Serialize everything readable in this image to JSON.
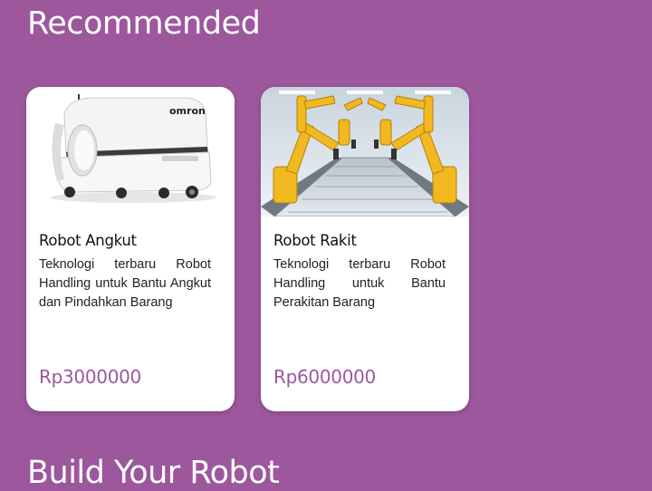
{
  "sections": {
    "recommended_title": "Recommended",
    "build_title": "Build Your Robot"
  },
  "products": [
    {
      "name": "Robot Angkut",
      "description": "Teknologi terbaru Robot Handling untuk Bantu Angkut dan Pindahkan Barang",
      "price": "Rp3000000",
      "image_icon": "mobile-robot-omron-image",
      "brand_text": "omron"
    },
    {
      "name": "Robot Rakit",
      "description": "Teknologi terbaru Robot Handling untuk Bantu Perakitan Barang",
      "price": "Rp6000000",
      "image_icon": "robotic-arms-assembly-line-image"
    }
  ],
  "colors": {
    "background": "#9c579d",
    "card": "#ffffff",
    "price": "#9c579d",
    "robot_arm": "#f2b81f"
  }
}
